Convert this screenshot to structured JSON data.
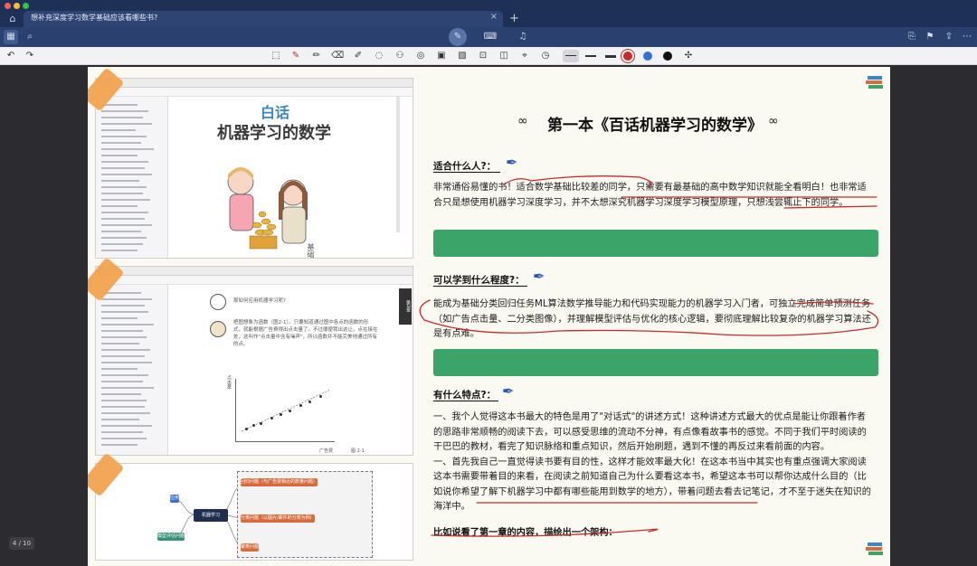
{
  "tab": {
    "title": "想补充深度学习数学基础应该看哪些书?",
    "close": "×",
    "add": "+"
  },
  "toolbar": {
    "left": [
      {
        "name": "grid",
        "glyph": "▦"
      },
      {
        "name": "search",
        "glyph": "⌕"
      }
    ],
    "modes": [
      {
        "name": "pen",
        "glyph": "✎"
      },
      {
        "name": "keyboard",
        "glyph": "⌨"
      },
      {
        "name": "mic",
        "glyph": "♫"
      }
    ],
    "right": [
      {
        "name": "export",
        "glyph": "⎘"
      },
      {
        "name": "bookmark",
        "glyph": "⚑"
      },
      {
        "name": "share",
        "glyph": "⇪"
      },
      {
        "name": "more",
        "glyph": "⋯"
      }
    ]
  },
  "drawing_tools": [
    "↶",
    "↷",
    "⬚",
    "✎",
    "✏",
    "⌫",
    "✐",
    "◌",
    "⚇",
    "◎",
    "▣",
    "▧",
    "⊡",
    "◫",
    "⌖",
    "◷"
  ],
  "colors": {
    "red": "#c92a2a",
    "blue": "#2f6fe0",
    "black": "#111111",
    "green": "#3aa469",
    "tape": "#f2a24f"
  },
  "page_indicator": "4 / 10",
  "notes": {
    "title": "第一本《百话机器学习的数学》",
    "sections": [
      {
        "heading": "适合什么人?：",
        "text": "非常通俗易懂的书！适合数学基础比较差的同学，只需要有最基础的高中数学知识就能全看明白！也非常适合只是想使用机器学习深度学习，并不太想深究机器学习深度学习模型原理，只想浅尝辄止下的同学。"
      },
      {
        "heading": "可以学到什么程度?：",
        "text": "能成为基础分类回归任务ML算法数学推导能力和代码实现能力的机器学习入门者，可独立完成简单预测任务（如广告点击量、二分类图像），并理解模型评估与优化的核心逻辑，要彻底理解比较复杂的机器学习算法还是有点难。"
      },
      {
        "heading": "有什么特点?：",
        "text": "一、我个人觉得这本书最大的特色是用了\"对话式\"的讲述方式！这种讲述方式最大的优点是能让你跟着作者的思路非常顺畅的阅读下去，可以感受思维的流动不分神，有点像看故事书的感觉。不同于我们平时阅读的干巴巴的教材，看完了知识脉络和重点知识，然后开始刷题，遇到不懂的再反过来看前面的内容。\n一、首先我自己一直觉得读书要有目的性，这样才能效率最大化！在这本书当中其实也有重点强调大家阅读这本书需要带着目的来看，在阅读之前知道自己为什么要看这本书，希望这本书可以帮你达成什么目的（比如说你希望了解下机器学习中都有哪些能用到数学的地方），带着问题去看去记笔记，才不至于迷失在知识的海洋中。"
      }
    ],
    "last_line": "比如说看了第一章的内容，描绘出一个架构："
  },
  "shots": {
    "book_title_small": "白话",
    "book_title_big": "机器学习的数学",
    "book_vertical": "基础数学",
    "chat_q": "那如何应用机器学习呢?",
    "chat_a": "把图想象为函数（图2-1）。只要知道通过图中各点的函数的形式，就能根据广告费得出点击量了。不过顺便我出这让，点在接在处，这叫作\"点击量中含有噪声\"，所以函数并不能完美地通过所有的点。",
    "chat_caption": "图 2-1",
    "axis_y": "点击量",
    "axis_x": "广告费",
    "chapter_tag": "第2章",
    "mind_center": "机器学习",
    "mind_nodes": [
      "回归问题（与广告费相近的数量问题）",
      "分类问题（以图片/邮件的分类为例）",
      "聚类问题",
      "应用",
      "模型评估问题"
    ]
  }
}
